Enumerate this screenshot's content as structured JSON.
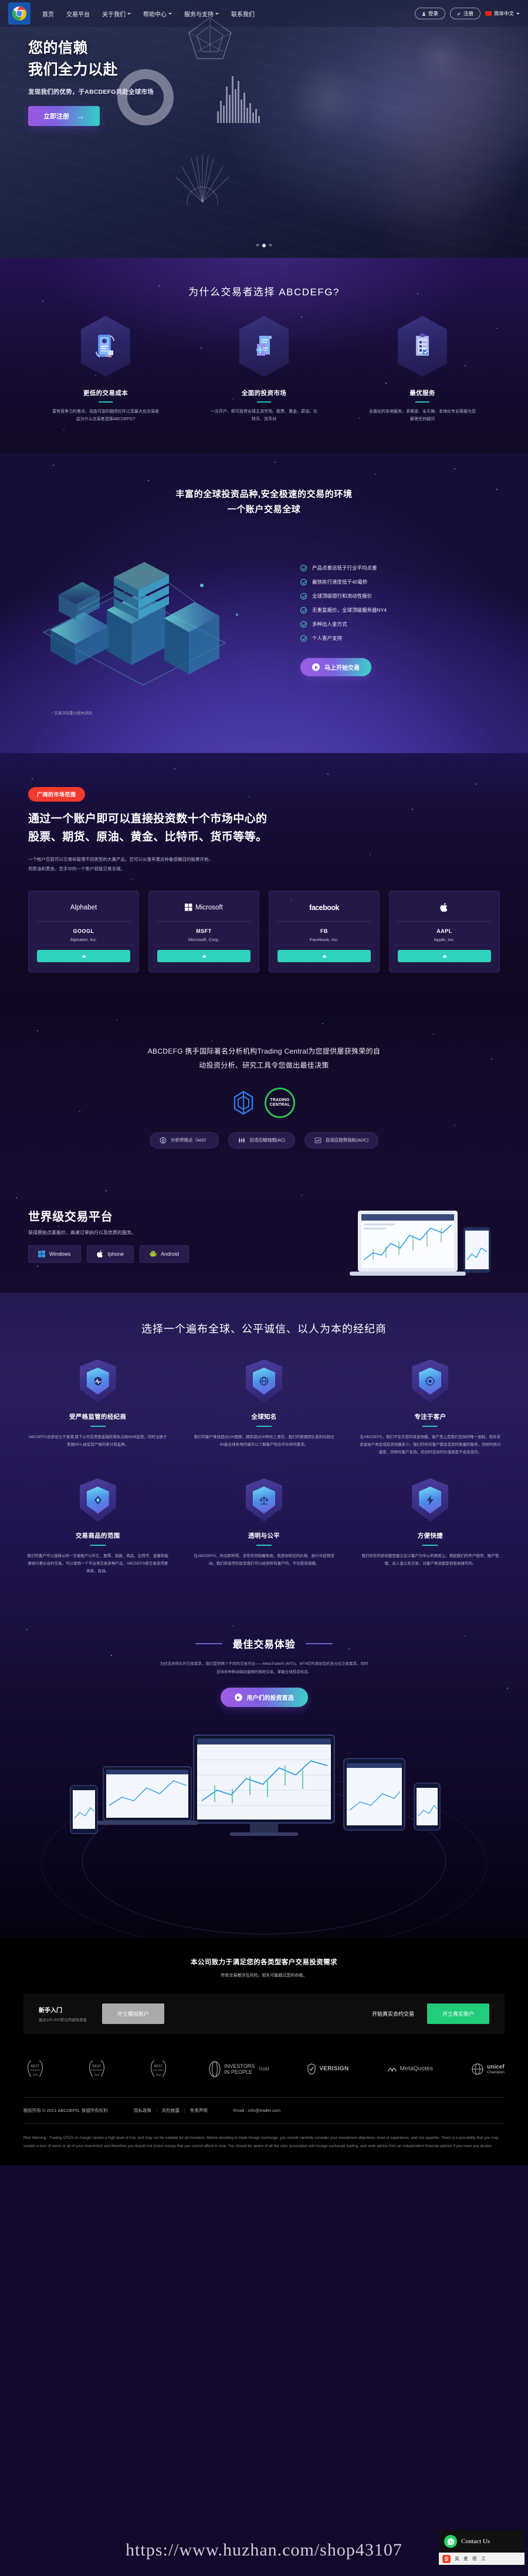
{
  "nav": {
    "logo_icon": "chrome-logo-icon",
    "items": [
      {
        "label": "首页",
        "has_caret": false
      },
      {
        "label": "交易平台",
        "has_caret": false
      },
      {
        "label": "关于我们",
        "has_caret": true
      },
      {
        "label": "帮助中心",
        "has_caret": true
      },
      {
        "label": "服务与支持",
        "has_caret": true
      },
      {
        "label": "联系我们",
        "has_caret": false
      }
    ],
    "login_label": "登录",
    "register_label": "注册",
    "language_label": "简体中文"
  },
  "hero": {
    "title_line1": "您的信赖",
    "title_line2": "我们全力以赴",
    "subtitle": "发现我们的优势，于ABCDEFG共赴全球市场",
    "cta_label": "立即注册",
    "cta_arrow": "→",
    "slide_count": 3,
    "active_slide": 2
  },
  "why": {
    "title": "为什么交易者选择 ABCDEFG?",
    "cards": [
      {
        "icon": "mobile-trade-icon",
        "title": "更低的交易成本",
        "desc": "富有竞争力的差点、动态可变的融资杠杆让您最大化交易收益为什么交易者选择ABCDEFG?"
      },
      {
        "icon": "document-globe-icon",
        "title": "全面的投资市场",
        "desc": "一次开户，即可投资全球主流市场、股票、黄金、原油、比特币、货币对"
      },
      {
        "icon": "checklist-icon",
        "title": "最优服务",
        "desc": "全面化的本地服务，多渠道、全天候、本地化专业客服为您解答任何疑问"
      }
    ]
  },
  "globe": {
    "title_line1": "丰富的全球投资品种,安全极速的交易的环境",
    "title_line2": "一个账户交易全球",
    "bullets": [
      "产品点差远低于行业平均点差",
      "最快执行速度低于40毫秒",
      "全球顶级银行和流动性报价",
      "无重复报价，全球顶级服务器NY4",
      "多种出入金方式",
      "个人客户支持"
    ],
    "cta_label": "马上开始交易",
    "note": "* 交易涉及重大损失风险"
  },
  "market": {
    "badge": "广阔的市场范围",
    "heading_line1": "通过一个账户即可以直接投资数十个市场中心的",
    "heading_line2": "股票、期货、原油、黄金、比特币、货币等等。",
    "desc_line1": "一个帐户您就可以交易和管理不同类型的大量产品。您可以从像苹果这种备受瞩目的股票开始，",
    "desc_line2": "到原油和黄金。您手中的一个账户就能交易全球。",
    "stocks": [
      {
        "brand": "Alphabet",
        "logo": "alphabet-logo",
        "ticker": "GOOGL",
        "company": "Alphabet, Inc."
      },
      {
        "brand": "Microsoft",
        "logo": "microsoft-logo",
        "ticker": "MSFT",
        "company": "Microsoft, Corp."
      },
      {
        "brand": "facebook",
        "logo": "facebook-logo",
        "ticker": "FB",
        "company": "Facebook, Inc."
      },
      {
        "brand": "",
        "logo": "apple-logo",
        "ticker": "AAPL",
        "company": "Apple, Inc."
      }
    ]
  },
  "trading_central": {
    "lead_line1": "ABCDEFG 携手国际著名分析机构Trading Central为您提供屡获殊荣的自",
    "lead_line2": "动投资分析、研究工具令您做出最佳决策",
    "logo_primary": "cube-logo-icon",
    "logo_secondary": "trading-central-logo",
    "logo_secondary_line1": "TRADING",
    "logo_secondary_line2": "CENTRAL",
    "chips": [
      {
        "icon": "analyst-opinion-icon",
        "label": "分析师观点（AOI）"
      },
      {
        "icon": "candlestick-icon",
        "label": "自适应蜡烛图(AC)"
      },
      {
        "icon": "trend-indicator-icon",
        "label": "自适应趋势指标(ADC)"
      }
    ]
  },
  "platform": {
    "title": "世界级交易平台",
    "subtitle": "获得原始点差报价，高速订单执行以及优质的服务。",
    "downloads": [
      {
        "icon": "windows-icon",
        "label": "Windows"
      },
      {
        "icon": "apple-icon",
        "label": "Iphone"
      },
      {
        "icon": "android-icon",
        "label": "Android"
      }
    ]
  },
  "broker": {
    "title": "选择一个遍布全球、公平诚信、以人为本的经纪商",
    "cells": [
      {
        "icon": "shield-pulse-icon",
        "title": "受严格监管的经纪商",
        "desc": "ABCDEFG总部设立于香港,旗下公司受美国金融犯罪执法局MSB监管，同时注册于美国NFA,接受其严格的审计和监察。"
      },
      {
        "icon": "globe-network-icon",
        "title": "全球知名",
        "desc": "我们的客户来自超过100国家，拥有超过30种员工语言。我们的管理团队曾到访超过60座全球各地的城市以了解客户和合作伙伴的需求。"
      },
      {
        "icon": "target-user-icon",
        "title": "专注于客户",
        "desc": "在ABCDEFG，我们不在乎您的资金规模，客户至上是我们坚持的唯一准则，而并非资金账户类型或投资规模多少。我们的所有客户都会受到同质量的服务，同样的执行速度，同样的客户支持。初创时坚持的价值观是不会改变的。"
      },
      {
        "icon": "exchange-arrows-icon",
        "title": "交易商品的范围",
        "desc": "我们的客户可以选择从同一交易账户以外汇、股票、指数、商品、比特币、金属和能源进行差价合约交易。可以使用一个平台来交易多种产品，ABCDEFG使交易变得更简单，有效。"
      },
      {
        "icon": "scales-icon",
        "title": "透明与公平",
        "desc": "在ABCDEFG，所见即所得，没有任何隐藏条款。就是你所见的价格、执行与促销活动。我们所宣传的就是我们可以给到所有客户的，不论投资规模。"
      },
      {
        "icon": "lightning-icon",
        "title": "方便快捷",
        "desc": "我们所有的系统都是建立在以客户为中心的原则上。例如我们的开户程序、账户管理、出入金以及交易，对客户来说都是很容易操作的。"
      }
    ]
  },
  "best": {
    "title": "最佳交易体验",
    "lead_line1": "为纪念多样化的交易需求，我们提供两个不同的交易平台——MetaTrader5 (MT5)、MT4均可满足您的多元化交易需求。同时",
    "lead_line2": "支持多种移动端设备随时随地交易，掌握全球投资机会。",
    "cta_label": "用户们的投资首选"
  },
  "final": {
    "heading": "本公司致力于满足您的各类型客户交易投资需求",
    "warning": "所有交易都涉及风险，损失可能超过您的存款。",
    "beginner_title": "新手入门",
    "beginner_sub": "高达100,000美元的虚拟资金",
    "demo_button": "开立模拟账户",
    "live_label": "开始真实合约交易",
    "live_button": "开立真实账户",
    "awards": [
      {
        "name": "best-forex-broker-2019",
        "line1": "BEST",
        "line2": "Forex Broker",
        "year": "2019"
      },
      {
        "name": "best-global-research-2019",
        "line1": "BEST",
        "line2": "Global Research",
        "year": "2019"
      },
      {
        "name": "best-forex-platform-2019",
        "line1": "BEST",
        "line2": "Forex Platform",
        "year": "2019"
      },
      {
        "name": "investors-in-people",
        "line1": "INVESTORS",
        "line2": "IN PEOPLE",
        "badge": "Gold"
      },
      {
        "name": "verisign",
        "line1": "VERISIGN"
      },
      {
        "name": "metaquotes",
        "line1": "MetaQuotes"
      },
      {
        "name": "unicef",
        "line1": "unicef",
        "line2": "Champion"
      }
    ],
    "copyright": "版权所有 © 2021 ABCDEFG, 保留所有权利",
    "links": [
      "隐私政策",
      "风险披露",
      "免责声明"
    ],
    "email": "Email : info@trader.com",
    "risk_label": "Risk Warning :",
    "risk_text": "Trading CFDS on margin carries a high level of risk, and may not be suitable for all investors. Before deciding to trade foreign exchange, you should carefully consider your investment objectives, level of experience, and risk appetite. There is a possibility that you may sustain a loss of some or all of your investment and therefore you should not invest money that you cannot afford to lose. You should be aware of all the risks associated with foreign exchange trading, and seek advice from an independent financial advisor if you have any doubts."
  },
  "overlay": {
    "watermark": "https://www.huzhan.com/shop43107",
    "chat_label": "Contact Us",
    "chat_icon": "whatsapp-icon",
    "toolbar_items": [
      "英",
      "中",
      "麦",
      "框",
      "工"
    ]
  },
  "colors": {
    "accent_teal": "#2bc6c0",
    "accent_purple": "#7f5ee2",
    "badge_red": "#f23a2e",
    "green_button": "#21cc7a",
    "grey_button": "#aaaaaa"
  }
}
